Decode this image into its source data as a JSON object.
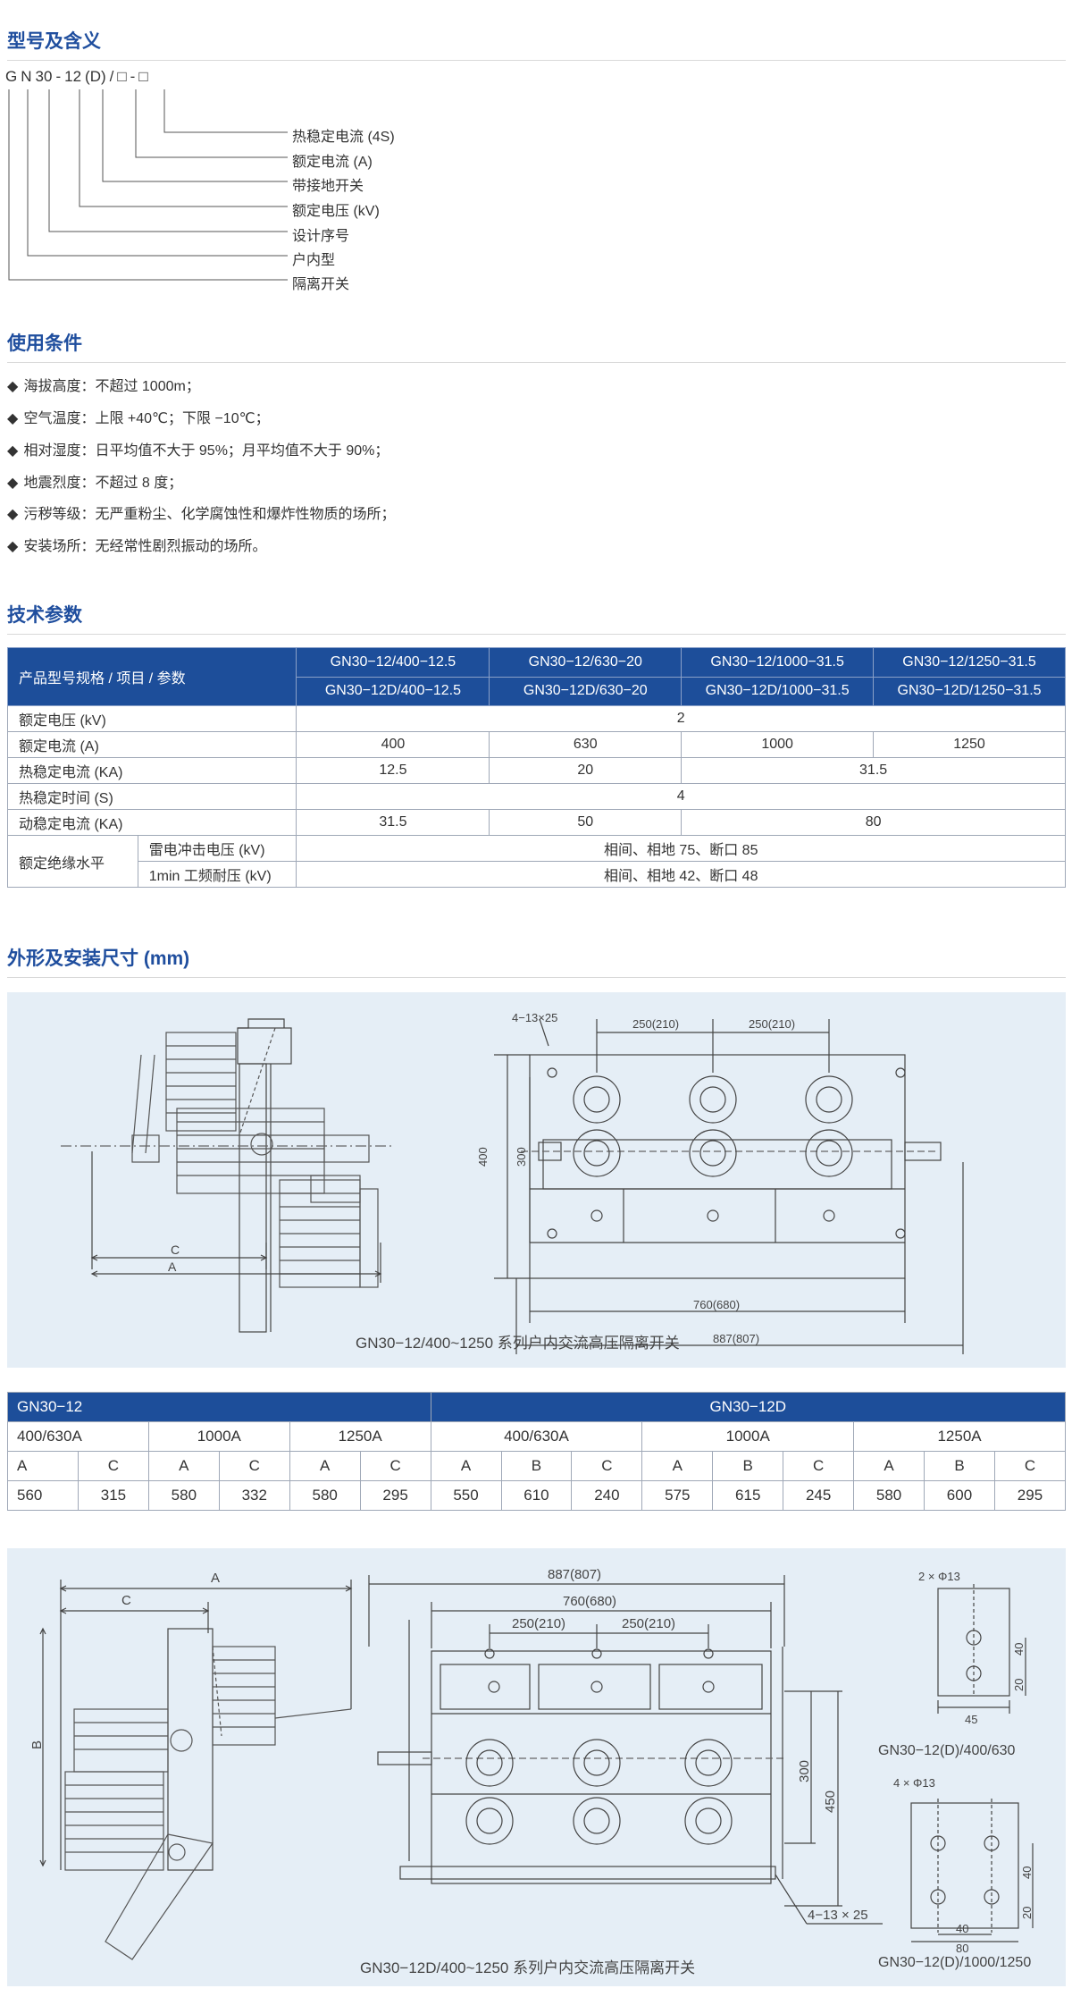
{
  "sections": {
    "model": "型号及含义",
    "conditions": "使用条件",
    "tech": "技术参数",
    "dims": "外形及安装尺寸 (mm)"
  },
  "model_code": [
    "G",
    "N",
    "30",
    "-",
    "12",
    "(D)",
    "/",
    "□",
    "-",
    "□"
  ],
  "model_legend": [
    "热稳定电流 (4S)",
    "额定电流 (A)",
    "带接地开关",
    "额定电压 (kV)",
    "设计序号",
    "户内型",
    "隔离开关"
  ],
  "conditions": [
    "海拔高度：不超过 1000m；",
    "空气温度：上限 +40℃；下限 −10℃；",
    "相对湿度：日平均值不大于 95%；月平均值不大于 90%；",
    "地震烈度：不超过 8 度；",
    "污秽等级：无严重粉尘、化学腐蚀性和爆炸性物质的场所；",
    "安装场所：无经常性剧烈振动的场所。"
  ],
  "param_table": {
    "corner": "产品型号规格 / 项目 / 参数",
    "models_top": [
      "GN30−12/400−12.5",
      "GN30−12/630−20",
      "GN30−12/1000−31.5",
      "GN30−12/1250−31.5"
    ],
    "models_bottom": [
      "GN30−12D/400−12.5",
      "GN30−12D/630−20",
      "GN30−12D/1000−31.5",
      "GN30−12D/1250−31.5"
    ],
    "rated_voltage": {
      "label": "额定电压 (kV)",
      "value": "2"
    },
    "rated_current": {
      "label": "额定电流 (A)",
      "values": [
        "400",
        "630",
        "1000",
        "1250"
      ]
    },
    "thermal_current": {
      "label": "热稳定电流 (KA)",
      "v1": "12.5",
      "v2": "20",
      "v3": "31.5"
    },
    "thermal_time": {
      "label": "热稳定时间 (S)",
      "value": "4"
    },
    "dynamic_current": {
      "label": "动稳定电流 (KA)",
      "v1": "31.5",
      "v2": "50",
      "v3": "80"
    },
    "insulation": {
      "label": "额定绝缘水平",
      "lightning_label": "雷电冲击电压 (kV)",
      "lightning_value": "相间、相地 75、断口 85",
      "power_label": "1min 工频耐压 (kV)",
      "power_value": "相间、相地 42、断口 48"
    }
  },
  "drawing1": {
    "caption": "GN30−12/400~1250 系列户内交流高压隔离开关",
    "labels": {
      "c": "C",
      "a": "A",
      "holes": "4−13×25",
      "w1": "250(210)",
      "w2": "250(210)",
      "h400": "400",
      "h300": "300",
      "w760": "760(680)",
      "w887": "887(807)"
    }
  },
  "dim_table": {
    "group1": "GN30−12",
    "group2": "GN30−12D",
    "ranges1": [
      "400/630A",
      "1000A",
      "1250A"
    ],
    "ranges2": [
      "400/630A",
      "1000A",
      "1250A"
    ],
    "cols1": [
      "A",
      "C",
      "A",
      "C",
      "A",
      "C"
    ],
    "cols2": [
      "A",
      "B",
      "C",
      "A",
      "B",
      "C",
      "A",
      "B",
      "C"
    ],
    "vals1": [
      "560",
      "315",
      "580",
      "332",
      "580",
      "295"
    ],
    "vals2": [
      "550",
      "610",
      "240",
      "575",
      "615",
      "245",
      "580",
      "600",
      "295"
    ]
  },
  "drawing2": {
    "caption": "GN30−12D/400~1250 系列户内交流高压隔离开关",
    "caption_right": "GN30−12(D)/1000/1250",
    "caption_right_top": "GN30−12(D)/400/630",
    "labels": {
      "a": "A",
      "c": "C",
      "b": "B",
      "w887": "887(807)",
      "w760": "760(680)",
      "w1": "250(210)",
      "w2": "250(210)",
      "h300": "300",
      "h450": "450",
      "holes": "4−13 × 25",
      "hole2": "2 × Φ13",
      "d40a": "40",
      "d20a": "20",
      "d45": "45",
      "hole4": "4 × Φ13",
      "d40b": "40",
      "d20b": "20",
      "d40c": "40",
      "d80": "80"
    }
  },
  "colors": {
    "accent": "#1f4e9e",
    "table_header": "#1d4e9a",
    "panel": "#e5eef6"
  }
}
